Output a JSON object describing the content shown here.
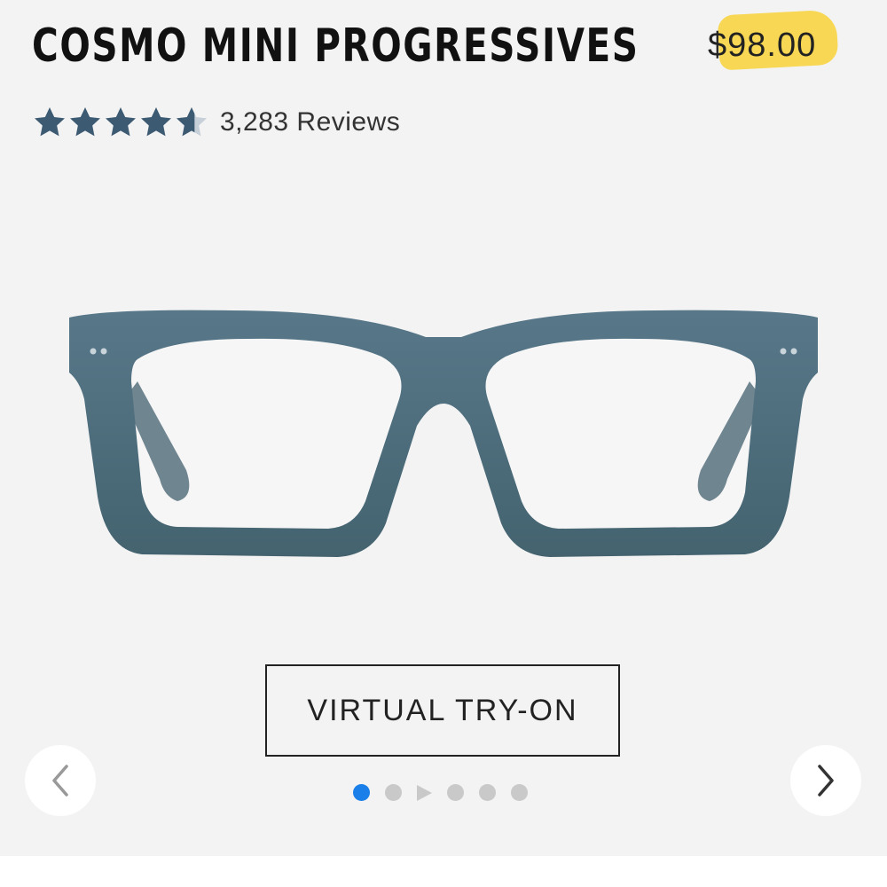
{
  "product": {
    "title": "COSMO MINI PROGRESSIVES",
    "price": "$98.00",
    "rating_stars": 4.5,
    "reviews_text": "3,283 Reviews",
    "image_icon": "eyeglasses-image"
  },
  "actions": {
    "virtual_try_on": "VIRTUAL TRY-ON"
  },
  "carousel": {
    "prev_icon": "chevron-left-icon",
    "next_icon": "chevron-right-icon",
    "items": [
      "image",
      "image",
      "video",
      "image",
      "image",
      "image"
    ],
    "active_index": 0
  },
  "colors": {
    "background": "#f3f3f3",
    "star": "#3d5a73",
    "frame": "#4b6b7d",
    "price_highlight": "#f7d54a",
    "active_dot": "#1a7fe8",
    "inactive_dot": "#c9c9c9"
  }
}
